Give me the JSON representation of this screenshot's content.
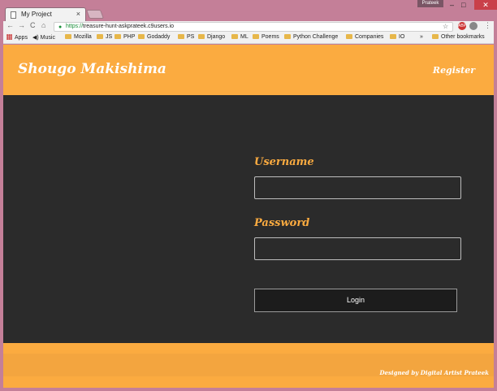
{
  "browser": {
    "tab_title": "My Project",
    "tab_close": "×",
    "profile_name": "Prateek",
    "url_scheme": "https://",
    "url_rest": "treasure-hunt-askprateek.c9users.io",
    "nav_back": "←",
    "nav_forward": "→",
    "nav_reload": "C",
    "nav_home": "⌂",
    "star": "☆",
    "menu": "⋮",
    "win_minimize": "–",
    "win_maximize": "□",
    "win_close": "✕"
  },
  "bookmarks": {
    "apps": "Apps",
    "items": [
      "Music",
      "Mozilla",
      "JS",
      "PHP",
      "Godaddy",
      "PS",
      "Django",
      "ML",
      "Poems",
      "Python Challenge",
      "Companies",
      "IO"
    ],
    "overflow": "»",
    "other": "Other bookmarks"
  },
  "site": {
    "brand": "Shougo Makishima",
    "register_label": "Register",
    "username_label": "Username",
    "password_label": "Password",
    "username_value": "",
    "password_value": "",
    "login_label": "Login",
    "footer_credit": "Designed by Digital Artist Prateek"
  },
  "colors": {
    "accent": "#fbab40",
    "panel": "#2b2b2b"
  }
}
